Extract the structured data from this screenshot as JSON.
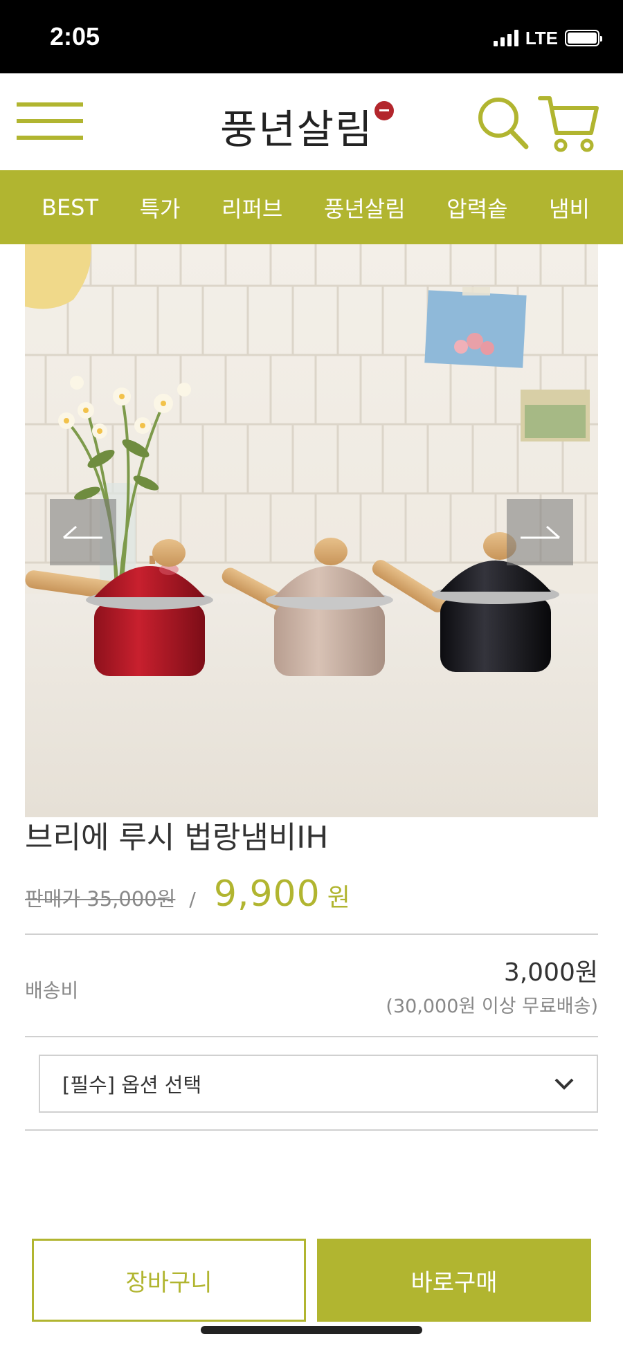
{
  "status_bar": {
    "time": "2:05",
    "network": "LTE",
    "icons": [
      "signal-icon",
      "battery-icon"
    ]
  },
  "header": {
    "logo_text": "풍년살림",
    "icons": [
      "menu-icon",
      "search-icon",
      "cart-icon"
    ]
  },
  "categories": [
    "BEST",
    "특가",
    "리퍼브",
    "풍년살림",
    "압력솥",
    "냄비"
  ],
  "gallery": {
    "image_alt": "Three enamel saucepans (red, beige, black) with wooden handles on a white counter",
    "icons": [
      "arrow-left-icon",
      "arrow-right-icon"
    ]
  },
  "product": {
    "title": "브리에 루시 법랑냄비IH",
    "original_price": "판매가 35,000원",
    "separator": "/",
    "sale_price": "9,900",
    "sale_unit": "원"
  },
  "shipping": {
    "label": "배송비",
    "fee": "3,000원",
    "note": "(30,000원 이상 무료배송)"
  },
  "option": {
    "placeholder": "[필수] 옵션 선택",
    "icon": "chevron-down-icon"
  },
  "actions": {
    "cart_label": "장바구니",
    "buy_label": "바로구매"
  },
  "colors": {
    "brand": "#b1b530",
    "seal": "#b3262c"
  }
}
